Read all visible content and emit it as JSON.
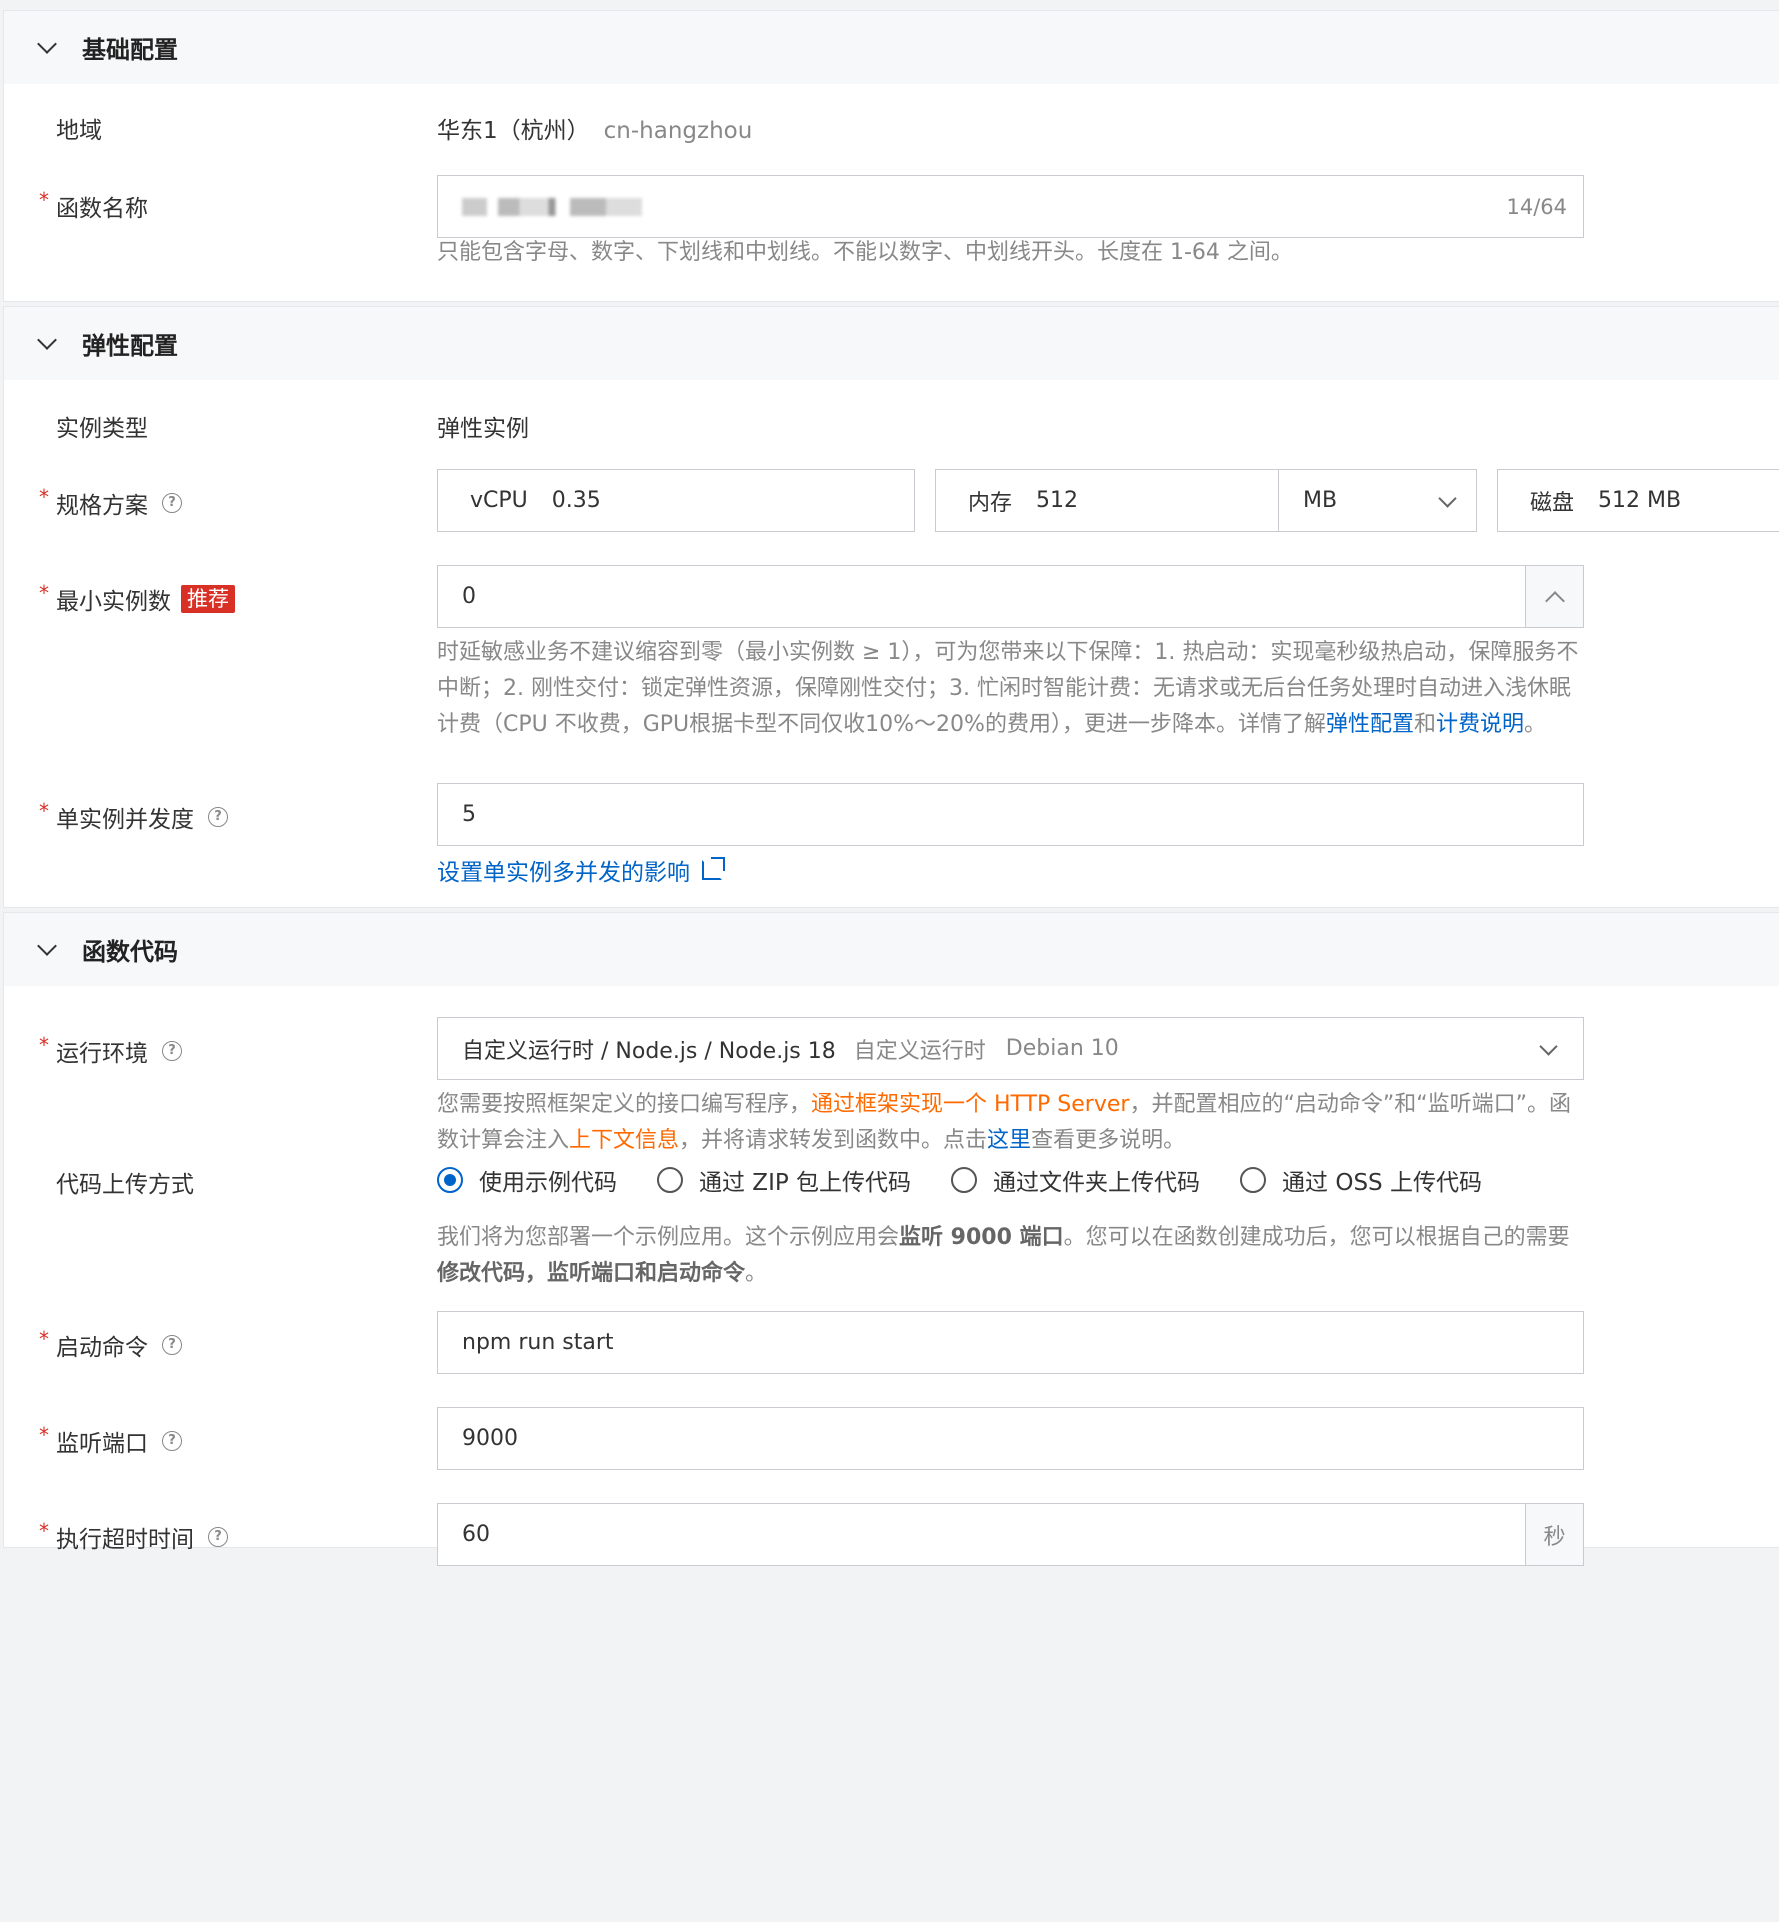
{
  "basic": {
    "title": "基础配置",
    "region_label": "地域",
    "region_value": "华东1（杭州）",
    "region_code": "cn-hangzhou",
    "func_name_label": "函数名称",
    "func_name_counter": "14/64",
    "func_name_hint": "只能包含字母、数字、下划线和中划线。不能以数字、中划线开头。长度在 1-64 之间。"
  },
  "elastic": {
    "title": "弹性配置",
    "instance_type_label": "实例类型",
    "instance_type_value": "弹性实例",
    "spec_label": "规格方案",
    "vcpu_key": "vCPU",
    "vcpu_value": "0.35",
    "mem_key": "内存",
    "mem_value": "512",
    "mem_unit": "MB",
    "disk_key": "磁盘",
    "disk_value": "512 MB",
    "min_instances_label": "最小实例数",
    "min_instances_badge": "推荐",
    "min_instances_value": "0",
    "min_hint_text": "时延敏感业务不建议缩容到零（最小实例数 ≥ 1），可为您带来以下保障：1. 热启动：实现毫秒级热启动，保障服务不中断；2. 刚性交付：锁定弹性资源，保障刚性交付；3. 忙闲时智能计费：无请求或无后台任务处理时自动进入浅休眠计费（CPU 不收费，GPU根据卡型不同仅收10%～20%的费用），更进一步降本。详情了解",
    "min_hint_link1": "弹性配置",
    "min_hint_and": "和",
    "min_hint_link2": "计费说明",
    "min_hint_end": "。",
    "concurrency_label": "单实例并发度",
    "concurrency_value": "5",
    "concurrency_link": "设置单实例多并发的影响"
  },
  "code": {
    "title": "函数代码",
    "runtime_label": "运行环境",
    "runtime_value": "自定义运行时 / Node.js / Node.js 18",
    "runtime_extra1": "自定义运行时",
    "runtime_extra2": "Debian 10",
    "runtime_hint_1": "您需要按照框架定义的接口编写程序，",
    "runtime_hint_link1": "通过框架实现一个 HTTP Server",
    "runtime_hint_2": "，并配置相应的“启动命令”和“监听端口”。函数计算会注入",
    "runtime_hint_link2": "上下文信息",
    "runtime_hint_3": "，并将请求转发到函数中。点击",
    "runtime_hint_link3": "这里",
    "runtime_hint_4": "查看更多说明。",
    "upload_label": "代码上传方式",
    "upload_options": [
      "使用示例代码",
      "通过 ZIP 包上传代码",
      "通过文件夹上传代码",
      "通过 OSS 上传代码"
    ],
    "upload_hint_1": "我们将为您部署一个示例应用。这个示例应用会",
    "upload_hint_b1": "监听 9000 端口",
    "upload_hint_2": "。您可以在函数创建成功后，您可以根据自己的需要",
    "upload_hint_b2": "修改代码，监听端口和启动命令",
    "upload_hint_3": "。",
    "start_cmd_label": "启动命令",
    "start_cmd_value": "npm run start",
    "port_label": "监听端口",
    "port_value": "9000",
    "timeout_label": "执行超时时间",
    "timeout_value": "60",
    "timeout_unit": "秒"
  },
  "colors": {
    "link": "#0064c8",
    "required": "#d93026",
    "orange": "#ff6a00"
  }
}
